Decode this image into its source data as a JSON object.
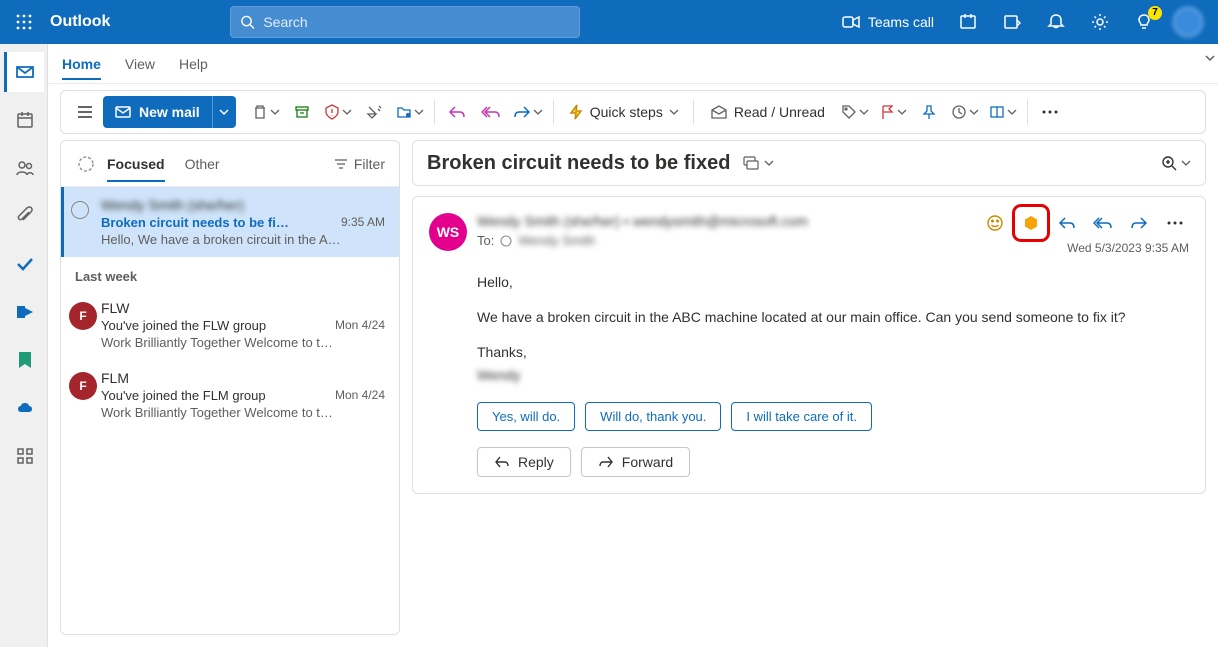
{
  "header": {
    "app_name": "Outlook",
    "search_placeholder": "Search",
    "teams_call": "Teams call",
    "notification_badge": "7"
  },
  "tabs": {
    "home": "Home",
    "view": "View",
    "help": "Help"
  },
  "ribbon": {
    "new_mail": "New mail",
    "quick_steps": "Quick steps",
    "read_unread": "Read / Unread"
  },
  "msg_list": {
    "focused": "Focused",
    "other": "Other",
    "filter": "Filter",
    "group_last_week": "Last week",
    "items": [
      {
        "sender": "Wendy Smith (she/her)",
        "subject": "Broken circuit needs to be fi…",
        "time": "9:35 AM",
        "preview": "Hello, We have a broken circuit in the A…"
      },
      {
        "sender": "FLW",
        "subject": "You've joined the FLW group",
        "time": "Mon 4/24",
        "preview": "Work Brilliantly Together Welcome to t…",
        "avatar": "F"
      },
      {
        "sender": "FLM",
        "subject": "You've joined the FLM group",
        "time": "Mon 4/24",
        "preview": "Work Brilliantly Together Welcome to t…",
        "avatar": "F"
      }
    ]
  },
  "reading": {
    "subject": "Broken circuit needs to be fixed",
    "avatar_initials": "WS",
    "from": "Wendy Smith (she/her)  •  wendysmith@microsoft.com",
    "to_label": "To:",
    "to_name": "Wendy Smith",
    "timestamp": "Wed 5/3/2023 9:35 AM",
    "body": {
      "greeting": "Hello,",
      "para1": "We have a broken circuit in the ABC machine located at   our main office. Can you send someone to fix it?",
      "thanks": "Thanks,",
      "signature": "Wendy"
    },
    "suggested": {
      "r1": "Yes, will do.",
      "r2": "Will do, thank you.",
      "r3": "I will take care of it."
    },
    "reply_btn": "Reply",
    "forward_btn": "Forward"
  }
}
